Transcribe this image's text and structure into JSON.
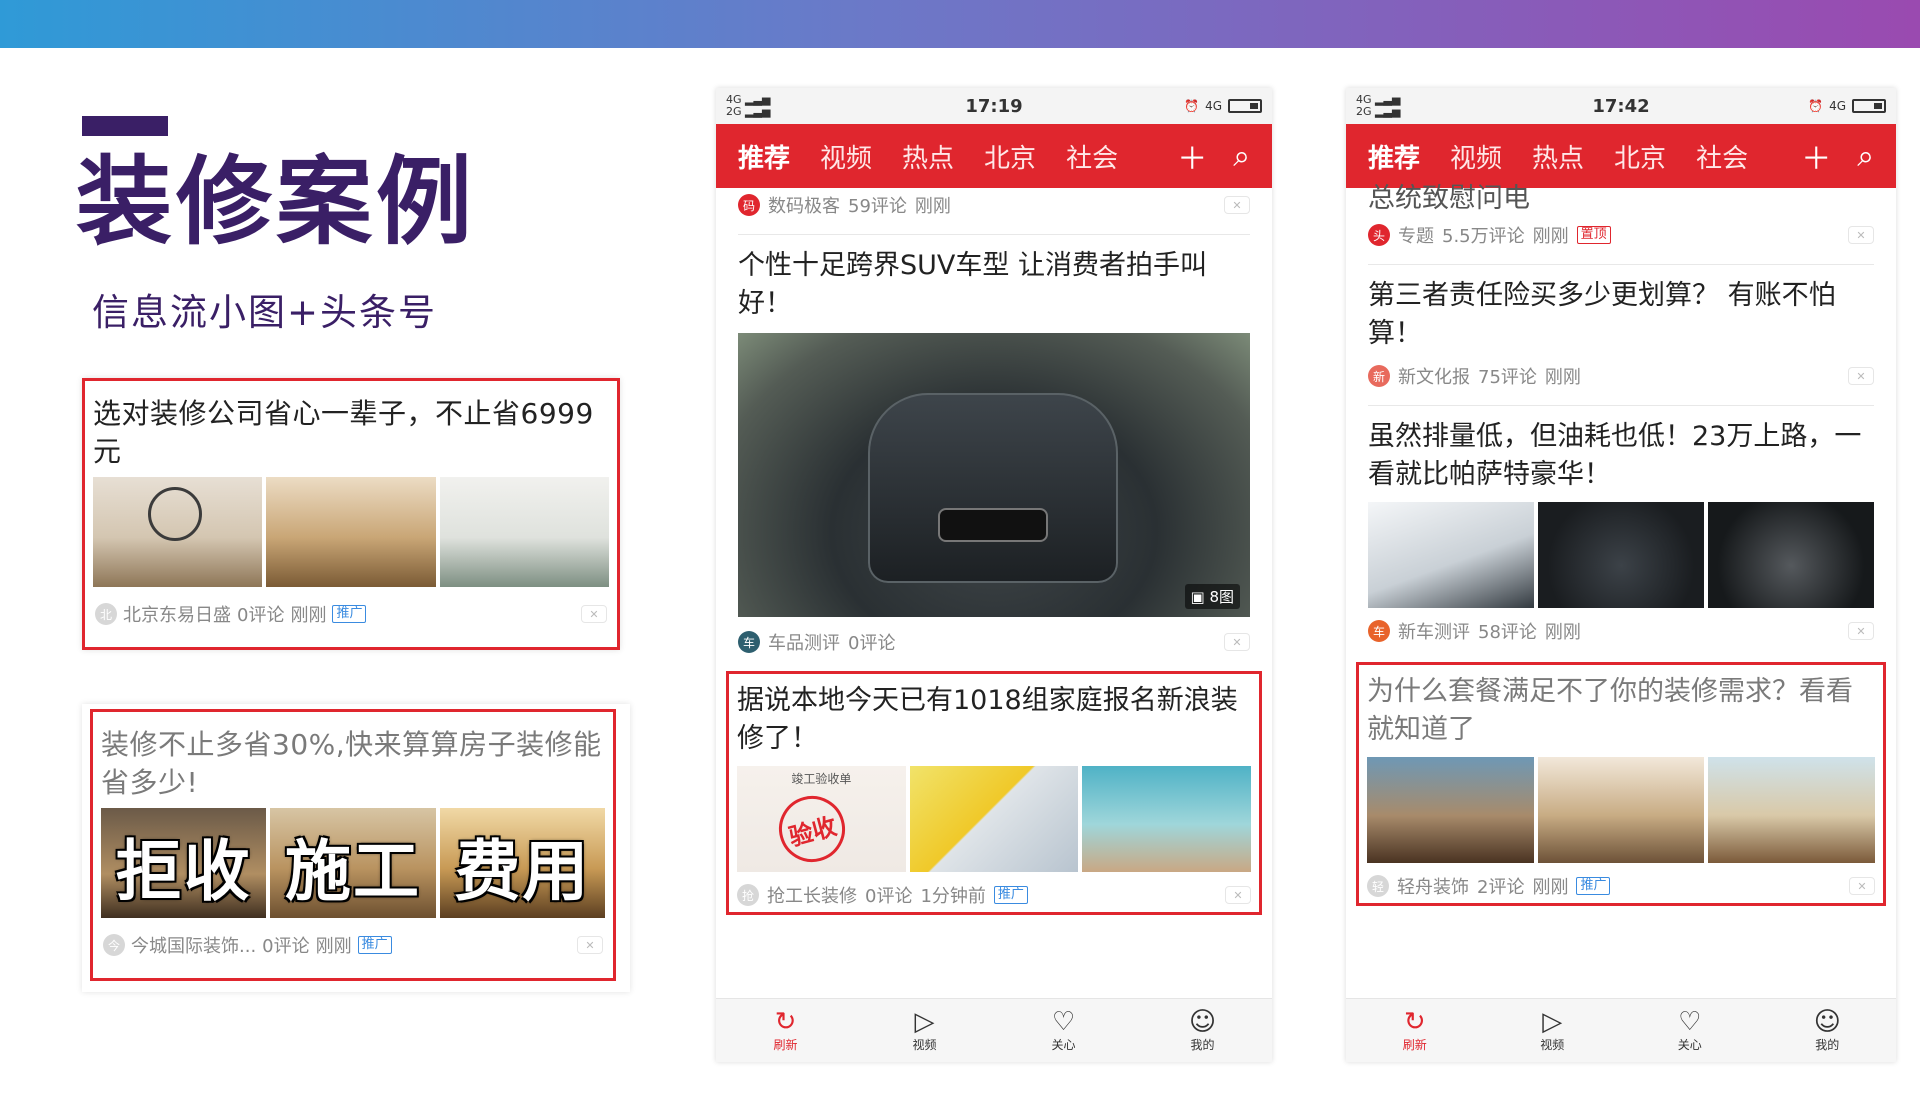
{
  "slide": {
    "title": "装修案例",
    "subtitle": "信息流小图+头条号"
  },
  "left_cards": [
    {
      "title": "选对装修公司省心一辈子，不止省6999元",
      "source": "北京东易日盛",
      "comments": "0评论",
      "time": "刚刚",
      "badge": "推广"
    },
    {
      "title": "装修不止多省30%,快来算算房子装修能省多少!",
      "overlay_words": [
        "拒收",
        "施工",
        "费用"
      ],
      "source": "今城国际装饰...",
      "comments": "0评论",
      "time": "刚刚",
      "badge": "推广"
    }
  ],
  "phone1": {
    "status": {
      "signal_top": "4G",
      "signal_bottom": "2G",
      "time": "17:19",
      "network": "4G"
    },
    "nav_tabs": [
      "推荐",
      "视频",
      "热点",
      "北京",
      "社会"
    ],
    "items": [
      {
        "source": "数码极客",
        "comments": "59评论",
        "time": "刚刚"
      },
      {
        "title": "个性十足跨界SUV车型 让消费者拍手叫好！",
        "image_count": "8图",
        "source": "车品测评",
        "comments": "0评论"
      },
      {
        "title": "据说本地今天已有1018组家庭报名新浪装修了！",
        "form_title": "竣工验收单",
        "stamp": "验收",
        "source": "抢工长装修",
        "comments": "0评论",
        "time": "1分钟前",
        "badge": "推广"
      }
    ],
    "tabbar": [
      "刷新",
      "视频",
      "关心",
      "我的"
    ]
  },
  "phone2": {
    "status": {
      "signal_top": "4G",
      "signal_bottom": "2G",
      "time": "17:42",
      "network": "4G"
    },
    "nav_tabs": [
      "推荐",
      "视频",
      "热点",
      "北京",
      "社会"
    ],
    "items": [
      {
        "title": "总统致慰问电",
        "source": "专题",
        "comments": "5.5万评论",
        "time": "刚刚",
        "badge": "置顶"
      },
      {
        "title": "第三者责任险买多少更划算？ 有账不怕算！",
        "source": "新文化报",
        "comments": "75评论",
        "time": "刚刚"
      },
      {
        "title": "虽然排量低，但油耗也低！23万上路，一看就比帕萨特豪华！",
        "source": "新车测评",
        "comments": "58评论",
        "time": "刚刚"
      },
      {
        "title": "为什么套餐满足不了你的装修需求？看看就知道了",
        "source": "轻舟装饰",
        "comments": "2评论",
        "time": "刚刚",
        "badge": "推广"
      }
    ],
    "tabbar": [
      "刷新",
      "视频",
      "关心",
      "我的"
    ]
  },
  "colors": {
    "accent_red": "#e0262e",
    "title_purple": "#3a1f66",
    "ad_blue": "#3a8be0"
  }
}
